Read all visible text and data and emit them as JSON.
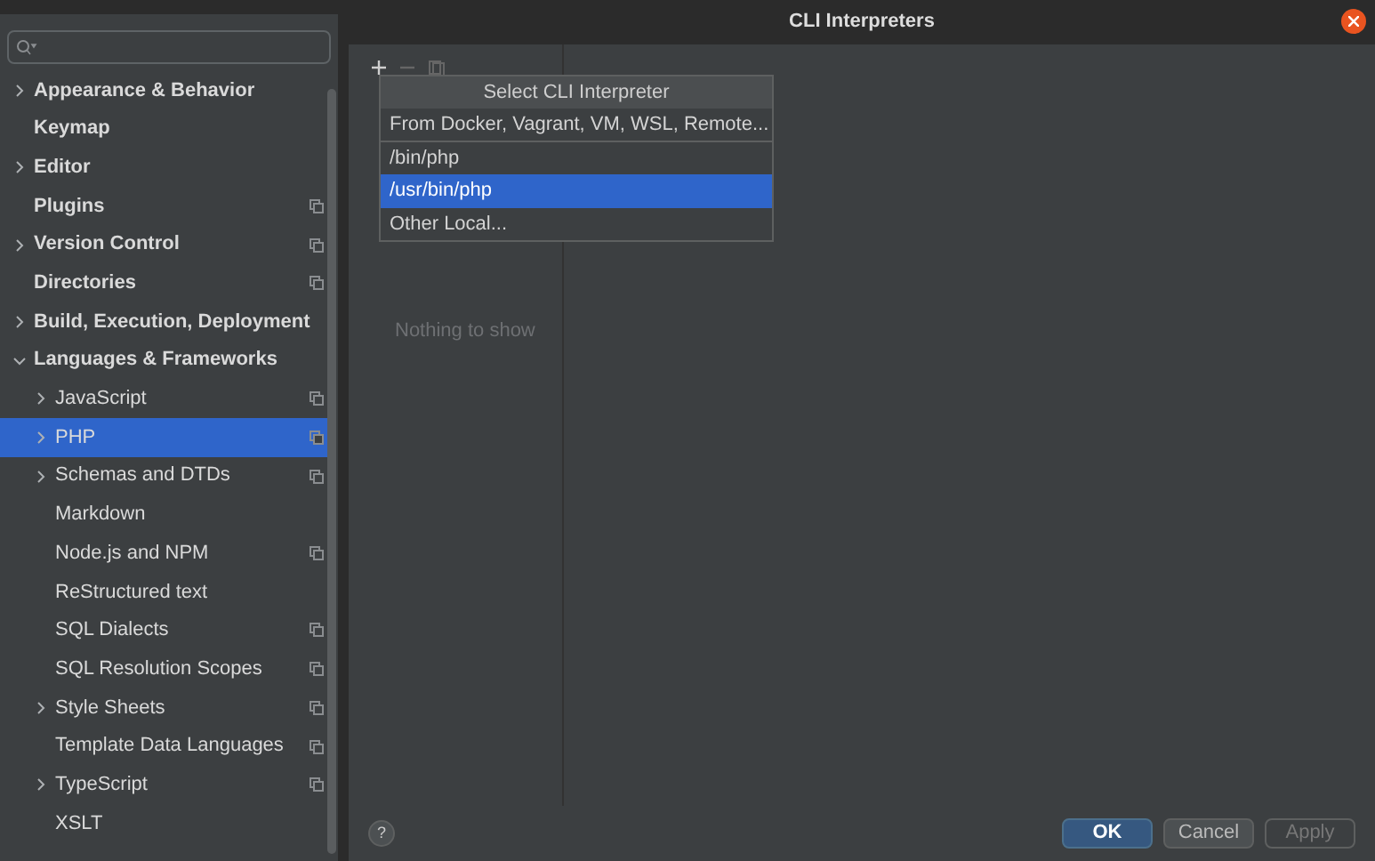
{
  "sidebar": {
    "items": [
      {
        "label": "Appearance & Behavior",
        "expandable": true,
        "expanded": false,
        "project_icon": false,
        "selected": false
      },
      {
        "label": "Keymap",
        "expandable": false,
        "expanded": false,
        "project_icon": false,
        "selected": false
      },
      {
        "label": "Editor",
        "expandable": true,
        "expanded": false,
        "project_icon": false,
        "selected": false
      },
      {
        "label": "Plugins",
        "expandable": false,
        "expanded": false,
        "project_icon": true,
        "selected": false
      },
      {
        "label": "Version Control",
        "expandable": true,
        "expanded": false,
        "project_icon": true,
        "selected": false
      },
      {
        "label": "Directories",
        "expandable": false,
        "expanded": false,
        "project_icon": true,
        "selected": false
      },
      {
        "label": "Build, Execution, Deployment",
        "expandable": true,
        "expanded": false,
        "project_icon": false,
        "selected": false
      },
      {
        "label": "Languages & Frameworks",
        "expandable": true,
        "expanded": true,
        "project_icon": false,
        "selected": false,
        "children": [
          {
            "label": "JavaScript",
            "expandable": true,
            "expanded": false,
            "project_icon": true,
            "selected": false
          },
          {
            "label": "PHP",
            "expandable": true,
            "expanded": false,
            "project_icon": true,
            "selected": true
          },
          {
            "label": "Schemas and DTDs",
            "expandable": true,
            "expanded": false,
            "project_icon": true,
            "selected": false
          },
          {
            "label": "Markdown",
            "expandable": false,
            "expanded": false,
            "project_icon": false,
            "selected": false
          },
          {
            "label": "Node.js and NPM",
            "expandable": false,
            "expanded": false,
            "project_icon": true,
            "selected": false
          },
          {
            "label": "ReStructured text",
            "expandable": false,
            "expanded": false,
            "project_icon": false,
            "selected": false
          },
          {
            "label": "SQL Dialects",
            "expandable": false,
            "expanded": false,
            "project_icon": true,
            "selected": false
          },
          {
            "label": "SQL Resolution Scopes",
            "expandable": false,
            "expanded": false,
            "project_icon": true,
            "selected": false
          },
          {
            "label": "Style Sheets",
            "expandable": true,
            "expanded": false,
            "project_icon": true,
            "selected": false
          },
          {
            "label": "Template Data Languages",
            "expandable": false,
            "expanded": false,
            "project_icon": true,
            "selected": false
          },
          {
            "label": "TypeScript",
            "expandable": true,
            "expanded": false,
            "project_icon": true,
            "selected": false
          },
          {
            "label": "XSLT",
            "expandable": false,
            "expanded": false,
            "project_icon": false,
            "selected": false
          }
        ]
      }
    ]
  },
  "dialog": {
    "title": "CLI Interpreters",
    "empty_text": "Nothing to show",
    "popup": {
      "title": "Select CLI Interpreter",
      "items": [
        {
          "label": "From Docker, Vagrant, VM, WSL, Remote...",
          "selected": false,
          "separator_after": true
        },
        {
          "label": "/bin/php",
          "selected": false,
          "separator_after": false
        },
        {
          "label": "/usr/bin/php",
          "selected": true,
          "separator_after": false
        },
        {
          "label": "Other Local...",
          "selected": false,
          "separator_after": false
        }
      ]
    },
    "help": "?",
    "buttons": [
      {
        "label": "OK",
        "kind": "primary"
      },
      {
        "label": "Cancel",
        "kind": "normal"
      },
      {
        "label": "Apply",
        "kind": "disabled"
      }
    ]
  }
}
